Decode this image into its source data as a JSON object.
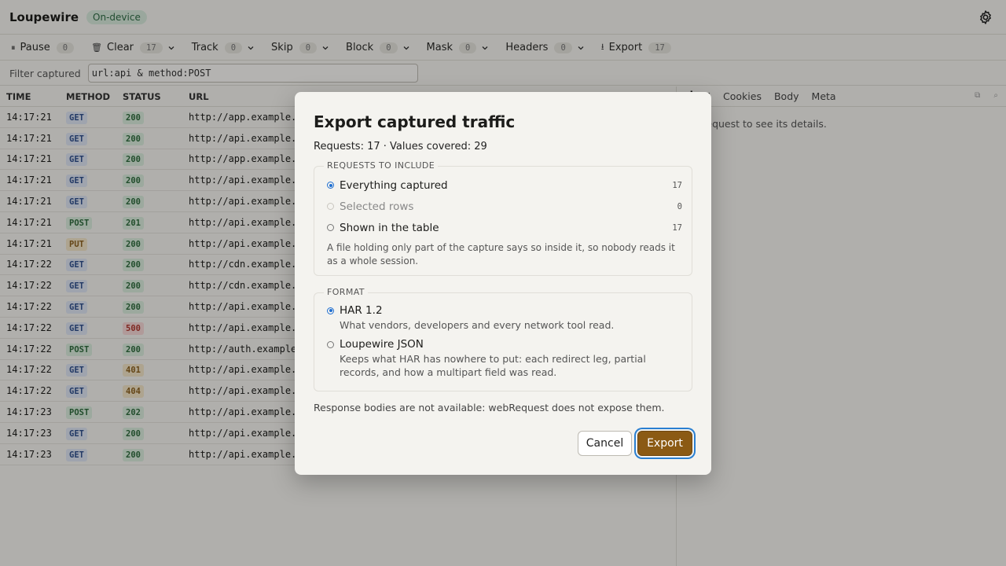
{
  "header": {
    "title": "Loupewire",
    "badge": "On-device"
  },
  "toolbar": [
    {
      "key": "pause",
      "icon": "pause-icon",
      "glyph": "⏸",
      "label": "Pause",
      "count": "0",
      "chevron": false
    },
    {
      "key": "clear",
      "icon": "trash-icon",
      "glyph": "🗑",
      "label": "Clear",
      "count": "17",
      "chevron": true
    },
    {
      "key": "track",
      "label": "Track",
      "count": "0",
      "chevron": true
    },
    {
      "key": "skip",
      "label": "Skip",
      "count": "0",
      "chevron": true
    },
    {
      "key": "block",
      "label": "Block",
      "count": "0",
      "chevron": true
    },
    {
      "key": "mask",
      "label": "Mask",
      "count": "0",
      "chevron": true
    },
    {
      "key": "headers",
      "label": "Headers",
      "count": "0",
      "chevron": true
    },
    {
      "key": "export",
      "icon": "download-icon",
      "glyph": "⭳",
      "label": "Export",
      "count": "17",
      "chevron": false
    }
  ],
  "filter": {
    "label": "Filter captured",
    "value": "url:api & method:POST"
  },
  "table": {
    "columns": [
      "TIME",
      "METHOD",
      "STATUS",
      "URL"
    ],
    "rows": [
      {
        "time": "14:17:21",
        "method": "GET",
        "status": "200",
        "url": "http://app.example."
      },
      {
        "time": "14:17:21",
        "method": "GET",
        "status": "200",
        "url": "http://api.example."
      },
      {
        "time": "14:17:21",
        "method": "GET",
        "status": "200",
        "url": "http://app.example."
      },
      {
        "time": "14:17:21",
        "method": "GET",
        "status": "200",
        "url": "http://api.example."
      },
      {
        "time": "14:17:21",
        "method": "GET",
        "status": "200",
        "url": "http://api.example."
      },
      {
        "time": "14:17:21",
        "method": "POST",
        "status": "201",
        "url": "http://api.example."
      },
      {
        "time": "14:17:21",
        "method": "PUT",
        "status": "200",
        "url": "http://api.example."
      },
      {
        "time": "14:17:22",
        "method": "GET",
        "status": "200",
        "url": "http://cdn.example."
      },
      {
        "time": "14:17:22",
        "method": "GET",
        "status": "200",
        "url": "http://cdn.example."
      },
      {
        "time": "14:17:22",
        "method": "GET",
        "status": "200",
        "url": "http://api.example."
      },
      {
        "time": "14:17:22",
        "method": "GET",
        "status": "500",
        "url": "http://api.example."
      },
      {
        "time": "14:17:22",
        "method": "POST",
        "status": "200",
        "url": "http://auth.example"
      },
      {
        "time": "14:17:22",
        "method": "GET",
        "status": "401",
        "url": "http://api.example."
      },
      {
        "time": "14:17:22",
        "method": "GET",
        "status": "404",
        "url": "http://api.example."
      },
      {
        "time": "14:17:23",
        "method": "POST",
        "status": "202",
        "url": "http://api.example."
      },
      {
        "time": "14:17:23",
        "method": "GET",
        "status": "200",
        "url": "http://api.example."
      },
      {
        "time": "14:17:23",
        "method": "GET",
        "status": "200",
        "url": "http://api.example."
      }
    ]
  },
  "panel": {
    "tabs": [
      {
        "label": "ders",
        "active": true
      },
      {
        "label": "Cookies",
        "active": false
      },
      {
        "label": "Body",
        "active": false
      },
      {
        "label": "Meta",
        "active": false
      }
    ],
    "hint": "t a request to see its details."
  },
  "dialog": {
    "title": "Export captured traffic",
    "summary": "Requests: 17 · Values covered: 29",
    "include": {
      "legend": "REQUESTS TO INCLUDE",
      "options": [
        {
          "label": "Everything captured",
          "count": "17",
          "selected": true,
          "disabled": false
        },
        {
          "label": "Selected rows",
          "count": "0",
          "selected": false,
          "disabled": true
        },
        {
          "label": "Shown in the table",
          "count": "17",
          "selected": false,
          "disabled": false
        }
      ],
      "note": "A file holding only part of the capture says so inside it, so nobody reads it as a whole session."
    },
    "format": {
      "legend": "FORMAT",
      "options": [
        {
          "label": "HAR 1.2",
          "desc": "What vendors, developers and every network tool read.",
          "selected": true
        },
        {
          "label": "Loupewire JSON",
          "desc": "Keeps what HAR has nowhere to put: each redirect leg, partial records, and how a multipart field was read.",
          "selected": false
        }
      ]
    },
    "footnote": "Response bodies are not available: webRequest does not expose them.",
    "cancel_label": "Cancel",
    "export_label": "Export"
  },
  "colors": {
    "accent": "#8b5a14",
    "focus": "#2a7fd1",
    "radio": "#1f6fd1"
  }
}
